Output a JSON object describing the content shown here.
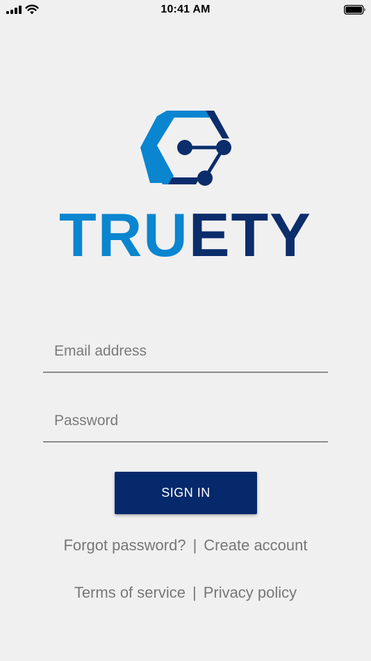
{
  "status_bar": {
    "time": "10:41 AM",
    "icons": [
      "cellular-signal-icon",
      "wifi-icon",
      "battery-icon"
    ]
  },
  "brand": {
    "logo_text_part1": "TRU",
    "logo_text_part2": "ETY",
    "colors": {
      "light_blue": "#0a85d0",
      "dark_blue": "#0b2d6b"
    }
  },
  "form": {
    "email": {
      "placeholder": "Email address",
      "value": ""
    },
    "password": {
      "placeholder": "Password",
      "value": ""
    },
    "signin_label": "SIGN IN",
    "button_color": "#06296b"
  },
  "links": {
    "forgot_password": "Forgot password?",
    "create_account": "Create account",
    "terms": "Terms of service",
    "privacy": "Privacy policy",
    "separator": "|"
  }
}
